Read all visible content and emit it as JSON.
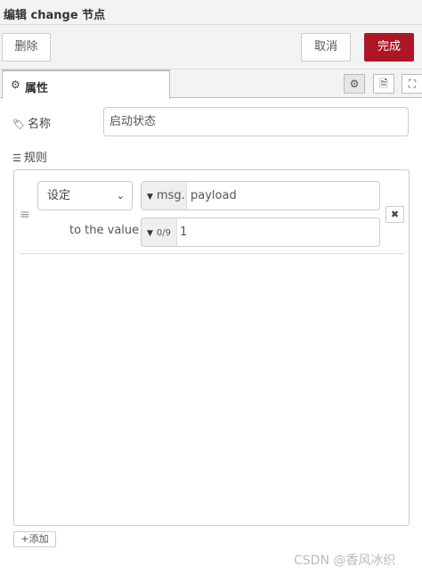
{
  "header": {
    "title": "编辑 change 节点"
  },
  "toolbar": {
    "delete_label": "删除",
    "cancel_label": "取消",
    "done_label": "完成"
  },
  "tabs": {
    "properties_label": "属性"
  },
  "form": {
    "name_label": "名称",
    "name_value": "启动状态",
    "rules_label": "规则"
  },
  "rule": {
    "action_value": "设定",
    "target_prefix": "msg.",
    "target_value": "payload",
    "to_label": "to the value",
    "value_type_prefix": "0/9",
    "value_value": "1"
  },
  "add_label": "添加",
  "watermark": "CSDN @香风冰织",
  "icons": {
    "tab_properties": "gear-icon",
    "settings": "gear-icon",
    "description": "document-icon",
    "appearance": "frame-icon",
    "name": "tag-icon",
    "rules": "list-icon",
    "drag": "drag-handle-icon",
    "remove": "close-icon",
    "add": "plus-icon"
  },
  "colors": {
    "primary": "#ad1625"
  }
}
